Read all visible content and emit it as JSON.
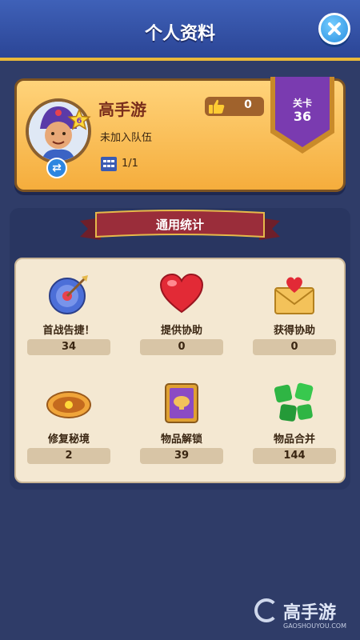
{
  "header": {
    "title": "个人资料"
  },
  "profile": {
    "name": "高手游",
    "team_status": "未加入队伍",
    "slot_count": "1/1",
    "likes": "0",
    "star_level": "6",
    "level_label": "关卡",
    "level_value": "36"
  },
  "stats": {
    "section_title": "通用统计",
    "items": [
      {
        "label": "首战告捷！",
        "value": "34",
        "icon": "dartboard-icon"
      },
      {
        "label": "提供协助",
        "value": "0",
        "icon": "heart-icon"
      },
      {
        "label": "获得协助",
        "value": "0",
        "icon": "envelope-heart-icon"
      },
      {
        "label": "修复秘境",
        "value": "2",
        "icon": "restore-emblem-icon"
      },
      {
        "label": "物品解锁",
        "value": "39",
        "icon": "item-book-icon"
      },
      {
        "label": "物品合并",
        "value": "144",
        "icon": "clover-icon"
      }
    ]
  },
  "watermark": {
    "cn": "高手游",
    "en": "GAOSHOUYOU.COM"
  },
  "colors": {
    "header": "#3f61b8",
    "accent_gold": "#f5ad3c",
    "level_banner": "#7a3bb0",
    "ribbon": "#9a2d3a"
  }
}
